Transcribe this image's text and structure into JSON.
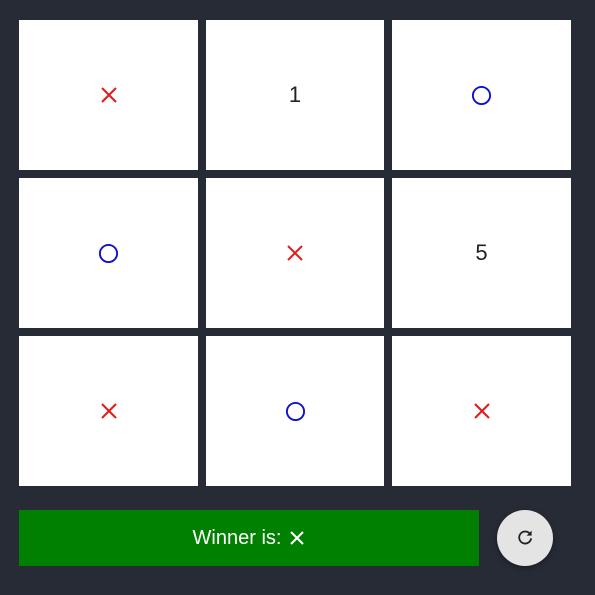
{
  "board": {
    "cells": [
      {
        "mark": "x",
        "label": ""
      },
      {
        "mark": "number",
        "label": "1"
      },
      {
        "mark": "o",
        "label": ""
      },
      {
        "mark": "o",
        "label": ""
      },
      {
        "mark": "x",
        "label": ""
      },
      {
        "mark": "number",
        "label": "5"
      },
      {
        "mark": "x",
        "label": ""
      },
      {
        "mark": "o",
        "label": ""
      },
      {
        "mark": "x",
        "label": ""
      }
    ]
  },
  "status": {
    "text": "Winner is:",
    "winner_icon": "x-icon",
    "background": "#008000"
  },
  "reset": {
    "icon": "refresh-icon"
  },
  "colors": {
    "x": "#e31b1b",
    "o": "#1111cc",
    "background": "#272b35",
    "cell": "#ffffff"
  }
}
